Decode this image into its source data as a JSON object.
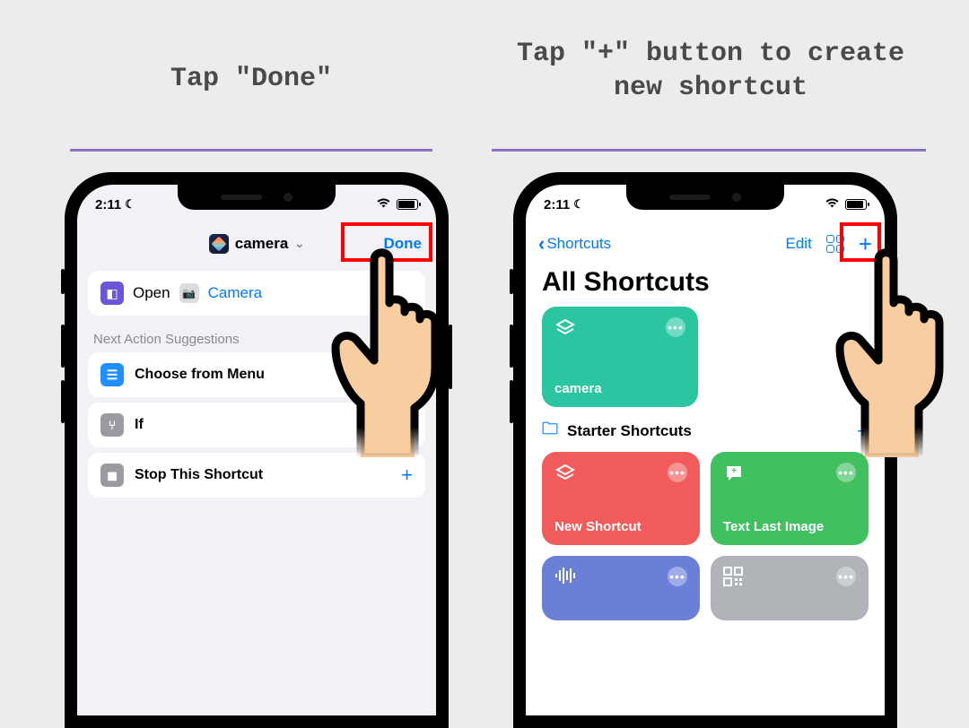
{
  "captions": {
    "left": "Tap \"Done\"",
    "right": "Tap \"+\" button to create new shortcut"
  },
  "status": {
    "time": "2:11"
  },
  "left_screen": {
    "title": "camera",
    "done": "Done",
    "action_open": "Open",
    "action_target": "Camera",
    "suggestions_header": "Next Action Suggestions",
    "suggestions": [
      {
        "label": "Choose from Menu",
        "icon": "menu"
      },
      {
        "label": "If",
        "icon": "branch"
      },
      {
        "label": "Stop This Shortcut",
        "icon": "stop"
      }
    ]
  },
  "right_screen": {
    "back": "Shortcuts",
    "edit": "Edit",
    "title": "All Shortcuts",
    "tile_camera": "camera",
    "folder": "Starter Shortcuts",
    "tiles": {
      "new_shortcut": "New Shortcut",
      "text_last_image": "Text Last Image"
    }
  }
}
